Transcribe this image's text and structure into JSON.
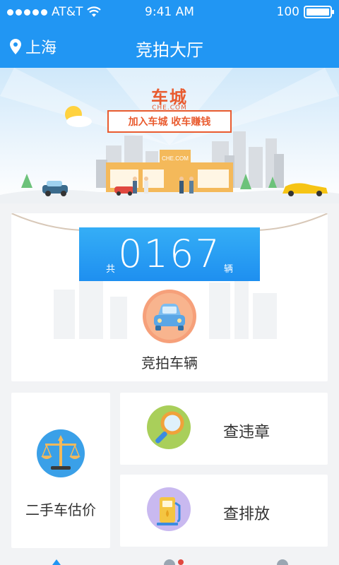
{
  "status_bar": {
    "carrier": "AT&T",
    "time": "9:41 AM",
    "battery": "100"
  },
  "nav": {
    "location": "上海",
    "title": "竞拍大厅"
  },
  "banner": {
    "logo": "车城",
    "logo_sub": "CHE.COM",
    "slogan": "加入车城 收车赚钱",
    "building_sign": "CHE.COM"
  },
  "auction": {
    "prefix": "共",
    "count": "0167",
    "suffix": "辆",
    "label": "竞拍车辆"
  },
  "tiles": {
    "valuation": {
      "label": "二手车估价"
    },
    "violation": {
      "label": "查违章"
    },
    "emission": {
      "label": "查排放"
    }
  },
  "colors": {
    "primary": "#2196f3",
    "brand": "#e95b2f"
  },
  "icons": {
    "location": "location-pin-icon",
    "wifi": "wifi-icon",
    "car": "car-icon",
    "scale": "scale-icon",
    "search": "magnifier-icon",
    "fuel": "fuel-pump-icon"
  }
}
